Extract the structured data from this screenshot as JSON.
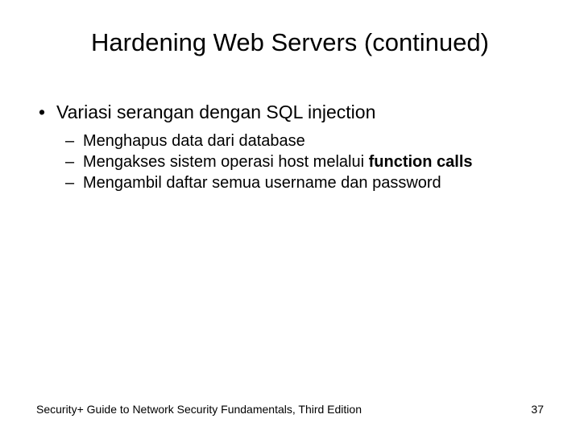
{
  "slide": {
    "title": "Hardening Web Servers (continued)",
    "bullet": {
      "marker": "•",
      "text": "Variasi serangan dengan SQL injection"
    },
    "subitems": [
      {
        "dash": "–",
        "text": "Menghapus data dari database"
      },
      {
        "dash": "–",
        "prefix": "Mengakses sistem operasi host melalui ",
        "bold": "function calls"
      },
      {
        "dash": "–",
        "text": "Mengambil daftar semua username dan password"
      }
    ],
    "footer": {
      "source": "Security+ Guide to Network Security Fundamentals, Third Edition",
      "page": "37"
    }
  }
}
